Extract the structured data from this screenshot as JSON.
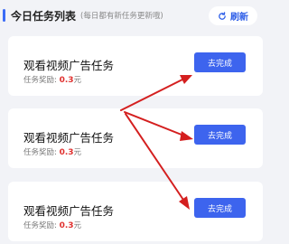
{
  "header": {
    "title": "今日任务列表",
    "subtitle": "(每日都有新任务更新哦)",
    "refresh_label": "刷新",
    "refresh_icon": "refresh-icon"
  },
  "tasks": [
    {
      "title": "观看视频广告任务",
      "reward_label": "任务奖励:",
      "reward_amount": "0.3",
      "reward_unit": "元",
      "button_label": "去完成"
    },
    {
      "title": "观看视频广告任务",
      "reward_label": "任务奖励:",
      "reward_amount": "0.3",
      "reward_unit": "元",
      "button_label": "去完成"
    },
    {
      "title": "观看视频广告任务",
      "reward_label": "任务奖励:",
      "reward_amount": "0.3",
      "reward_unit": "元",
      "button_label": "去完成"
    }
  ],
  "colors": {
    "accent": "#3d64ee",
    "reward": "#e0312f",
    "annotation_arrow": "#d41f1f",
    "background": "#f2f3f7"
  }
}
